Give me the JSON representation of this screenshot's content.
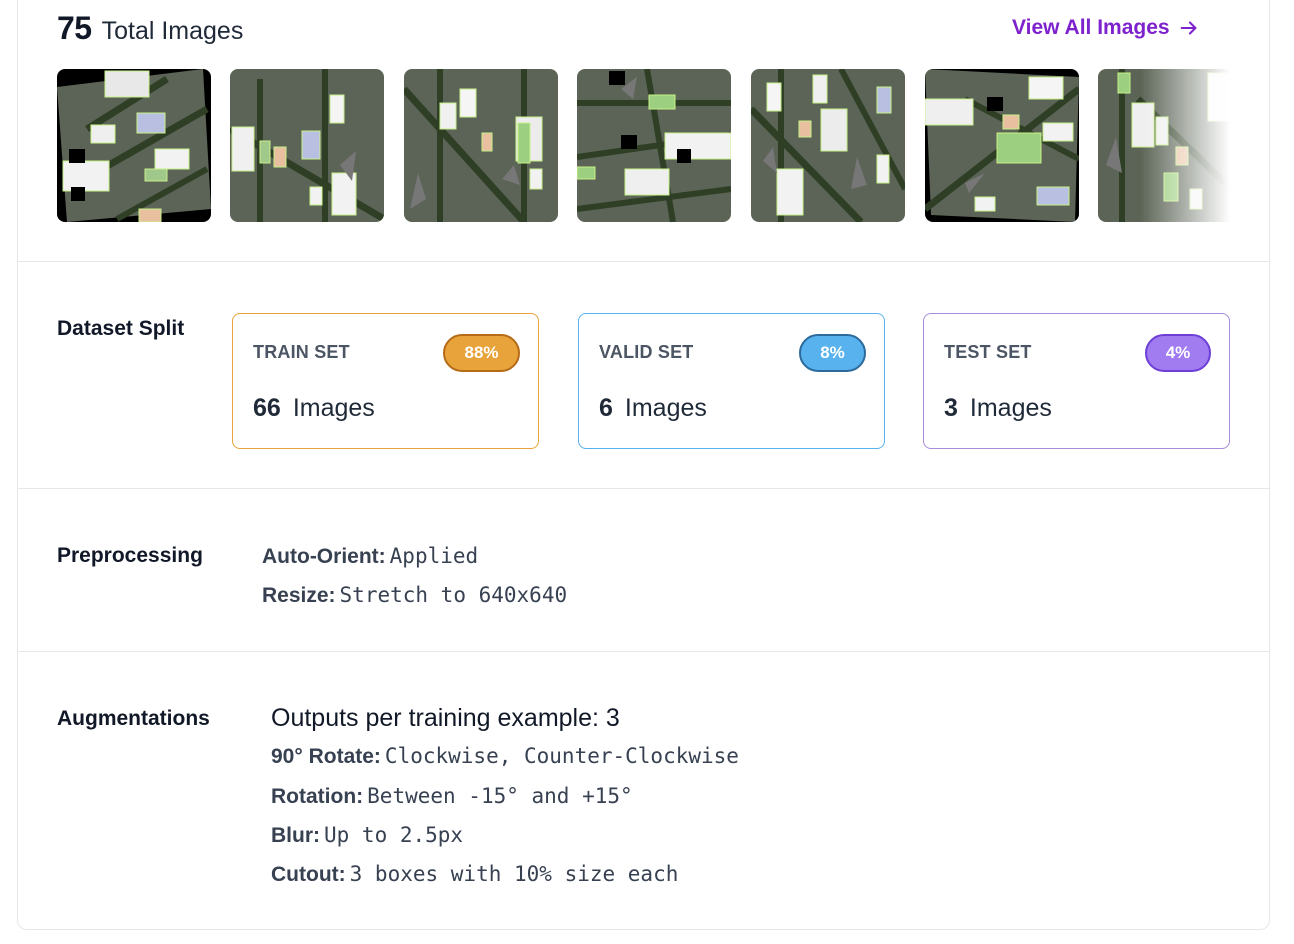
{
  "header": {
    "total_count": "75",
    "total_label": "Total Images",
    "view_all_label": "View All Images"
  },
  "thumbnails": [
    {
      "alt": "image-1"
    },
    {
      "alt": "image-2"
    },
    {
      "alt": "image-3"
    },
    {
      "alt": "image-4"
    },
    {
      "alt": "image-5"
    },
    {
      "alt": "image-6"
    },
    {
      "alt": "image-7"
    }
  ],
  "dataset_split": {
    "label": "Dataset Split",
    "train": {
      "title": "TRAIN SET",
      "percent": "88%",
      "count": "66",
      "unit": "Images",
      "color": "#e8a33a"
    },
    "valid": {
      "title": "VALID SET",
      "percent": "8%",
      "count": "6",
      "unit": "Images",
      "color": "#58b2ee"
    },
    "test": {
      "title": "TEST SET",
      "percent": "4%",
      "count": "3",
      "unit": "Images",
      "color": "#a07cf0"
    }
  },
  "preprocessing": {
    "label": "Preprocessing",
    "items": [
      {
        "key": "Auto-Orient:",
        "value": "Applied"
      },
      {
        "key": "Resize:",
        "value": "Stretch to 640x640"
      }
    ]
  },
  "augmentations": {
    "label": "Augmentations",
    "outputs": "Outputs per training example: 3",
    "items": [
      {
        "key": "90° Rotate:",
        "value": "Clockwise, Counter-Clockwise"
      },
      {
        "key": "Rotation:",
        "value": "Between -15° and +15°"
      },
      {
        "key": "Blur:",
        "value": "Up to 2.5px"
      },
      {
        "key": "Cutout:",
        "value": "3 boxes with 10% size each"
      }
    ]
  },
  "colors": {
    "accent": "#7e22ce",
    "thumb_bg": "#5b6456",
    "bbox": "#c8f08a"
  }
}
